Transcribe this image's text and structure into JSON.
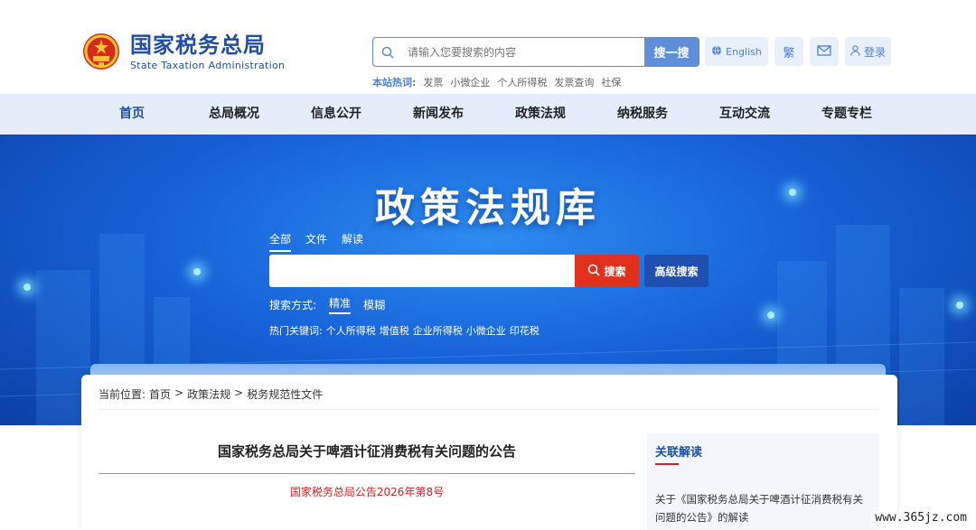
{
  "header": {
    "site_name_cn": "国家税务总局",
    "site_name_en": "State Taxation Administration",
    "search": {
      "placeholder": "请输入您要搜索的内容",
      "button": "搜一搜"
    },
    "hot_label": "本站热词:",
    "hot_words": [
      "发票",
      "小微企业",
      "个人所得税",
      "发票查询",
      "社保"
    ],
    "tools": {
      "english": "English",
      "traditional": "繁",
      "login": "登录"
    }
  },
  "nav": {
    "items": [
      "首页",
      "总局概况",
      "信息公开",
      "新闻发布",
      "政策法规",
      "纳税服务",
      "互动交流",
      "专题专栏"
    ],
    "active_index": 0
  },
  "banner": {
    "title": "政策法规库",
    "tabs": [
      "全部",
      "文件",
      "解读"
    ],
    "search_button": "搜索",
    "advanced_button": "高级搜索",
    "mode_label": "搜索方式:",
    "modes": [
      "精准",
      "模糊"
    ],
    "keywords_label": "热门关键词:",
    "keywords": [
      "个人所得税",
      "增值税",
      "企业所得税",
      "小微企业",
      "印花税"
    ]
  },
  "content": {
    "breadcrumb_label": "当前位置:",
    "breadcrumb": [
      "首页",
      "政策法规",
      "税务规范性文件"
    ],
    "separator": ">",
    "doc_title": "国家税务总局关于啤酒计征消费税有关问题的公告",
    "doc_number": "国家税务总局公告2026年第8号",
    "side": {
      "title": "关联解读",
      "link": "关于《国家税务总局关于啤酒计征消费税有关问题的公告》的解读"
    }
  },
  "watermark": "www.365jz.com",
  "colors": {
    "brand_blue": "#1f4fa3",
    "search_red": "#e0301e",
    "nav_bg": "#e4eefb"
  }
}
